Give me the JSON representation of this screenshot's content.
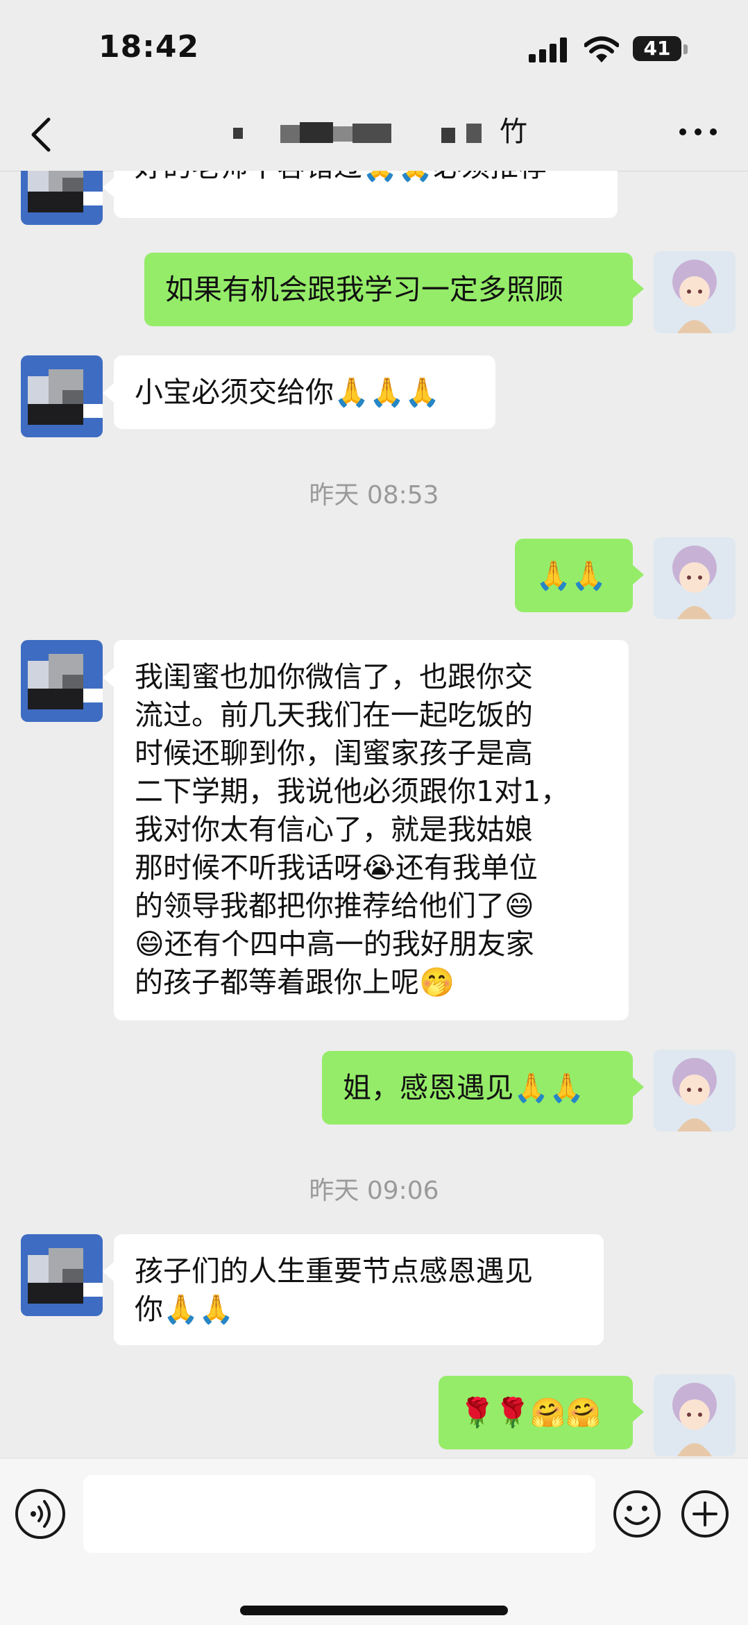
{
  "status": {
    "time": "18:42",
    "battery": "41"
  },
  "header": {
    "title": "竹"
  },
  "messages": [
    {
      "side": "left",
      "text": "好的老师不容错过",
      "suffix": "🙏🙏必须推荐"
    },
    {
      "side": "right",
      "text": "如果有机会跟我学习一定多照顾"
    },
    {
      "side": "left",
      "text": "小宝必须交给你",
      "suffix": "🙏🙏🙏"
    },
    {
      "type": "time",
      "text": "昨天 08:53"
    },
    {
      "side": "right",
      "text": "🙏🙏"
    },
    {
      "side": "left",
      "lines": [
        "我闺蜜也加你微信了，也跟你交",
        "流过。前几天我们在一起吃饭的",
        "时候还聊到你，闺蜜家孩子是高",
        "二下学期，我说他必须跟你1对1，",
        "我对你太有信心了，就是我姑娘",
        "那时候不听我话呀😭还有我单位",
        "的领导我都把你推荐给他们了😄",
        "😄还有个四中高一的我好朋友家",
        "的孩子都等着跟你上呢🤭"
      ]
    },
    {
      "side": "right",
      "text": "姐，感恩遇见",
      "suffix": "🙏🙏"
    },
    {
      "type": "time",
      "text": "昨天 09:06"
    },
    {
      "side": "left",
      "lines": [
        "孩子们的人生重要节点感恩遇见",
        "你🙏🙏"
      ]
    },
    {
      "side": "right",
      "text": "🌹🌹🤗🤗"
    }
  ],
  "input": {
    "placeholder": ""
  },
  "colors": {
    "background": "#ededed",
    "bubble_self": "#95ec69",
    "bubble_other": "#ffffff",
    "timestamp": "#9a9a9a"
  },
  "icons": [
    "back-arrow-icon",
    "more-dots-icon",
    "voice-icon",
    "emoji-face-icon",
    "plus-icon",
    "signal-icon",
    "wifi-icon",
    "battery-icon"
  ]
}
